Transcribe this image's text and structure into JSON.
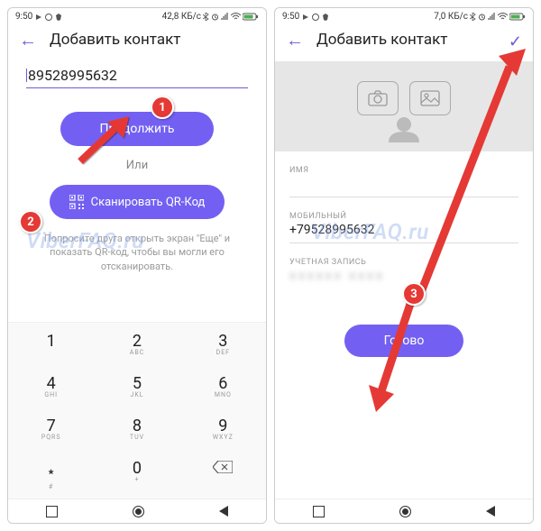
{
  "status": {
    "time": "9:50",
    "net1": "42,8 КБ/с",
    "net2": "7,0 КБ/с"
  },
  "badges": {
    "b1": "1",
    "b2": "2",
    "b3": "3"
  },
  "watermark": "ViberFAQ.ru",
  "left": {
    "title": "Добавить контакт",
    "number": "89528995632",
    "continue_btn": "Продолжить",
    "or_text": "Или",
    "qr_btn": "Сканировать QR-Код",
    "help": "Попросите друга открыть экран \"Еще\" и показать QR-код, чтобы вы могли его отсканировать."
  },
  "right": {
    "title": "Добавить контакт",
    "name_lbl": "ИМЯ",
    "mobile_lbl": "МОБИЛЬНЫЙ",
    "mobile_val": "+79528995632",
    "account_lbl": "УЧЕТНАЯ ЗАПИСЬ",
    "account_val": "hidden",
    "done_btn": "Готово"
  },
  "keypad": {
    "k1": "1",
    "k2": "2",
    "k3": "3",
    "k4": "4",
    "k5": "5",
    "k6": "6",
    "k7": "7",
    "k8": "8",
    "k9": "9",
    "k0": "0",
    "s2": "ABC",
    "s3": "DEF",
    "s4": "GHI",
    "s5": "JKL",
    "s6": "MNO",
    "s7": "PQRS",
    "s8": "TUV",
    "s9": "WXYZ",
    "s0": "+",
    "star": "﹡",
    "hash": "#"
  }
}
